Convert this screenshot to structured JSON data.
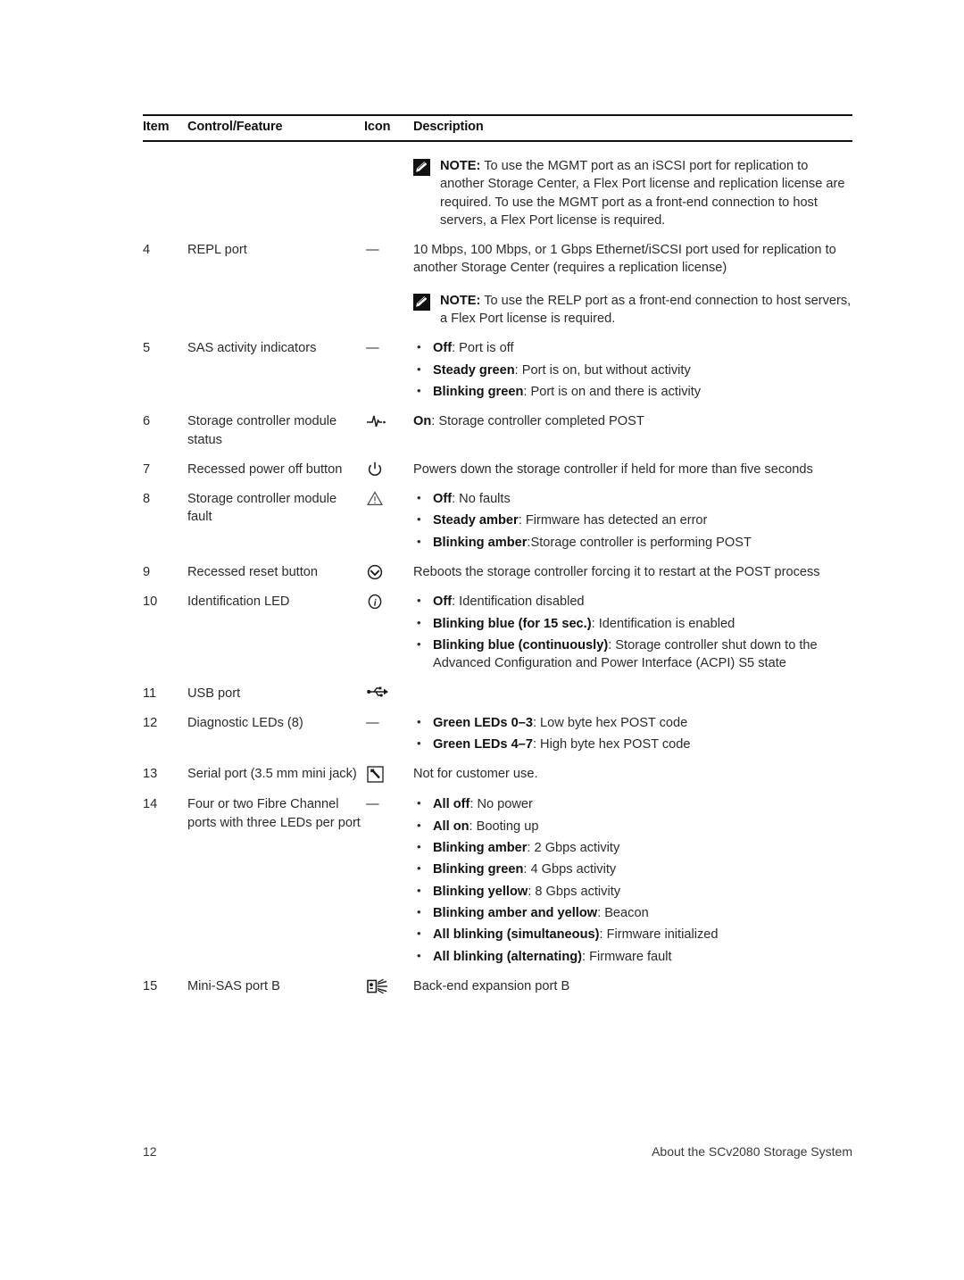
{
  "table": {
    "headers": {
      "item": "Item",
      "control": "Control/Feature",
      "icon": "Icon",
      "description": "Description"
    }
  },
  "note_top": {
    "label": "NOTE:",
    "text": " To use the MGMT port as an iSCSI port for replication to another Storage Center, a Flex Port license and replication license are required. To use the MGMT port as a front-end connection to host servers, a Flex Port license is required.",
    "icon": "note-pencil-icon"
  },
  "rows": [
    {
      "item": "4",
      "control": "REPL port",
      "icon_glyph": "—",
      "icon_name": "em-dash",
      "desc_text": "10 Mbps, 100 Mbps, or 1 Gbps Ethernet/iSCSI port used for replication to another Storage Center (requires a replication license)",
      "note": {
        "label": "NOTE:",
        "text": " To use the RELP port as a front-end connection to host servers, a Flex Port license is required."
      }
    },
    {
      "item": "5",
      "control": "SAS activity indicators",
      "icon_glyph": "—",
      "icon_name": "em-dash",
      "bullets": [
        {
          "bold": "Off",
          "rest": ": Port is off"
        },
        {
          "bold": "Steady green",
          "rest": ": Port is on, but without activity"
        },
        {
          "bold": "Blinking green",
          "rest": ": Port is on and there is activity"
        }
      ]
    },
    {
      "item": "6",
      "control": "Storage controller module status",
      "icon_name": "heartbeat-status-icon",
      "desc_bold": "On",
      "desc_rest": ": Storage controller completed POST"
    },
    {
      "item": "7",
      "control": "Recessed power off button",
      "icon_name": "power-off-icon",
      "desc_text": "Powers down the storage controller if held for more than five seconds"
    },
    {
      "item": "8",
      "control": "Storage controller module fault",
      "icon_name": "warning-triangle-icon",
      "bullets": [
        {
          "bold": "Off",
          "rest": ": No faults"
        },
        {
          "bold": "Steady amber",
          "rest": ": Firmware has detected an error"
        },
        {
          "bold": "Blinking amber",
          "rest": ":Storage controller is performing POST"
        }
      ]
    },
    {
      "item": "9",
      "control": "Recessed reset button",
      "icon_name": "reset-circle-icon",
      "desc_text": "Reboots the storage controller forcing it to restart at the POST process"
    },
    {
      "item": "10",
      "control": "Identification LED",
      "icon_name": "identification-info-icon",
      "bullets": [
        {
          "bold": "Off",
          "rest": ": Identification disabled"
        },
        {
          "bold": "Blinking blue (for 15 sec.)",
          "rest": ": Identification is enabled"
        },
        {
          "bold": "Blinking blue (continuously)",
          "rest": ": Storage controller shut down to the Advanced Configuration and Power Interface (ACPI) S5 state"
        }
      ]
    },
    {
      "item": "11",
      "control": "USB port",
      "icon_name": "usb-icon",
      "desc_text": ""
    },
    {
      "item": "12",
      "control": "Diagnostic LEDs (8)",
      "icon_glyph": "—",
      "icon_name": "em-dash",
      "bullets": [
        {
          "bold": "Green LEDs 0–3",
          "rest": ": Low byte hex POST code"
        },
        {
          "bold": "Green LEDs 4–7",
          "rest": ": High byte hex POST code"
        }
      ]
    },
    {
      "item": "13",
      "control": "Serial port (3.5 mm mini jack)",
      "icon_name": "serial-port-icon",
      "desc_text": "Not for customer use."
    },
    {
      "item": "14",
      "control": "Four or two Fibre Channel ports with three LEDs per port",
      "icon_glyph": "—",
      "icon_name": "em-dash",
      "bullets": [
        {
          "bold": "All off",
          "rest": ": No power"
        },
        {
          "bold": "All on",
          "rest": ": Booting up"
        },
        {
          "bold": "Blinking amber",
          "rest": ": 2 Gbps activity"
        },
        {
          "bold": "Blinking green",
          "rest": ": 4 Gbps activity"
        },
        {
          "bold": "Blinking yellow",
          "rest": ": 8 Gbps activity"
        },
        {
          "bold": "Blinking amber and yellow",
          "rest": ": Beacon"
        },
        {
          "bold": "All blinking (simultaneous)",
          "rest": ": Firmware initialized"
        },
        {
          "bold": "All blinking (alternating)",
          "rest": ": Firmware fault"
        }
      ]
    },
    {
      "item": "15",
      "control": "Mini-SAS port B",
      "icon_name": "mini-sas-port-icon",
      "desc_text": "Back-end expansion port B"
    }
  ],
  "footer": {
    "page_number": "12",
    "section_title": "About the SCv2080 Storage System"
  }
}
